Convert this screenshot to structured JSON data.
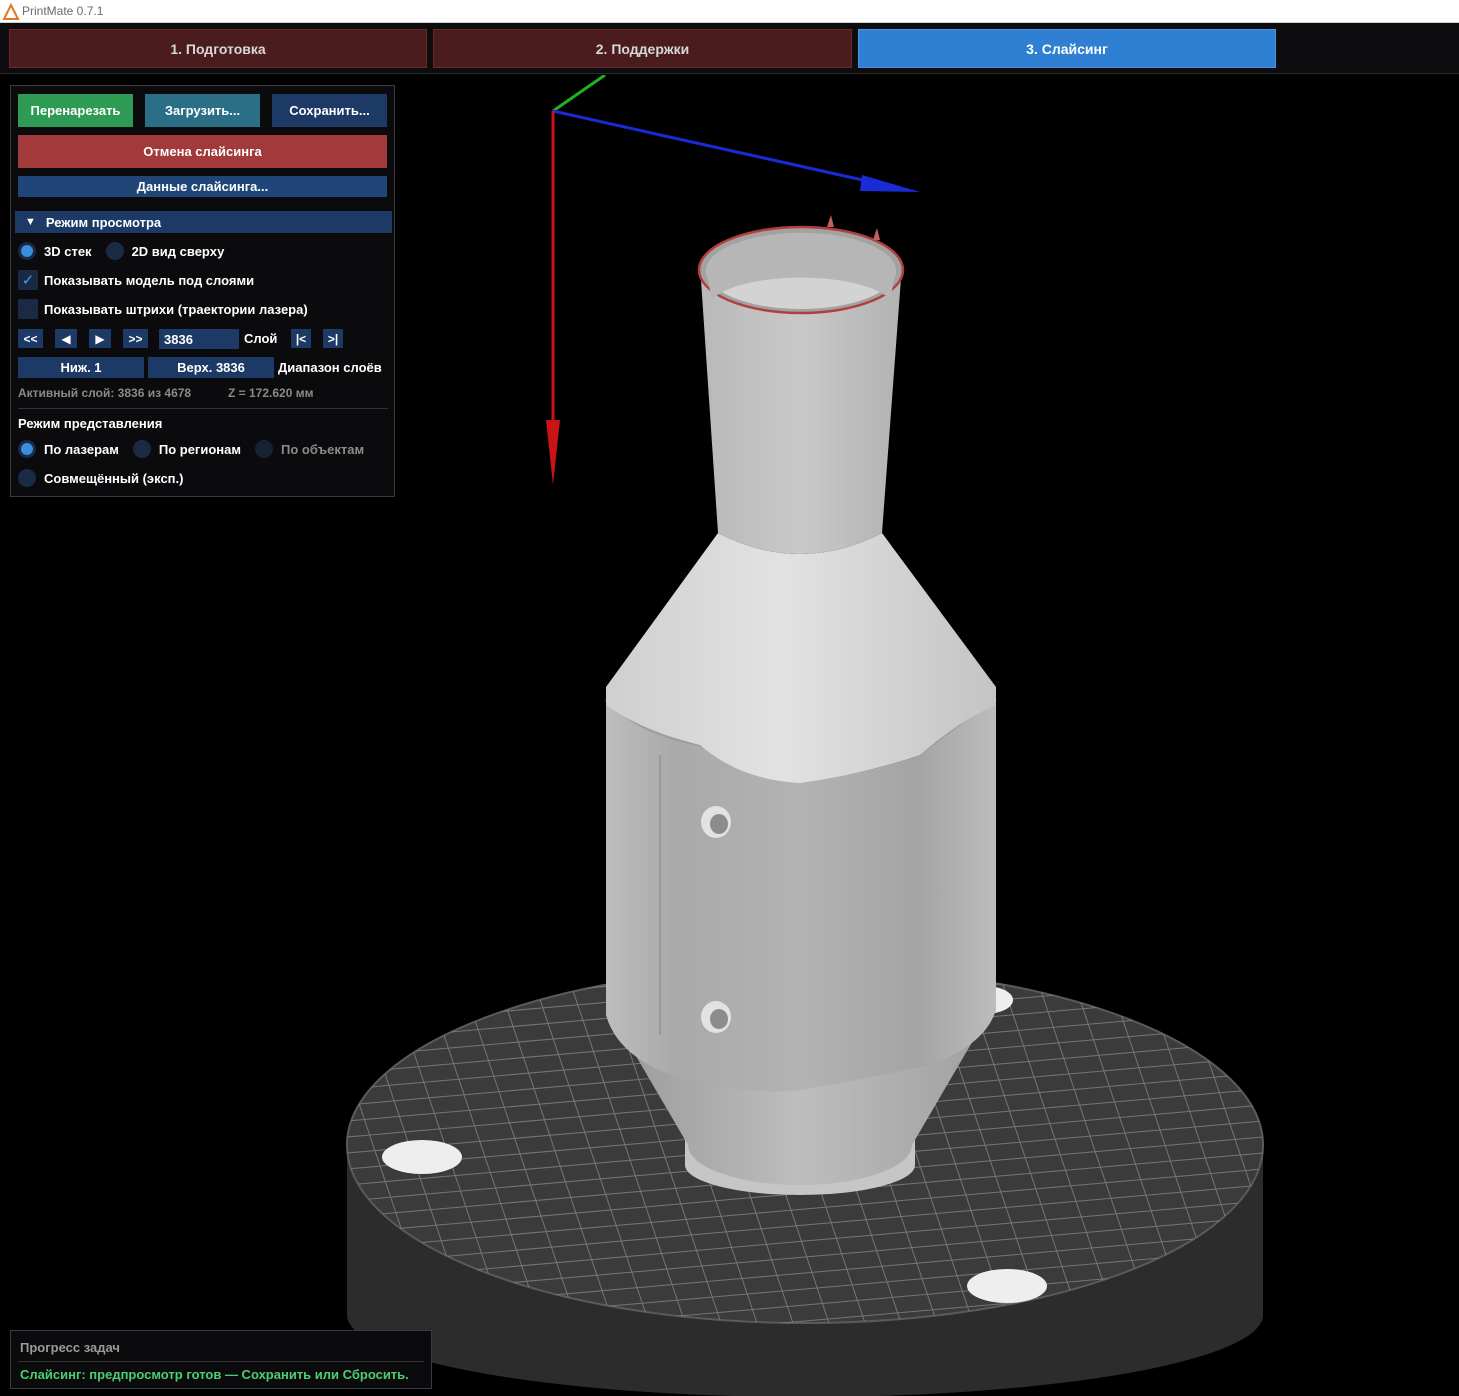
{
  "window": {
    "title": "PrintMate 0.7.1"
  },
  "tabs": [
    {
      "label": "1. Подготовка",
      "active": false
    },
    {
      "label": "2. Поддержки",
      "active": false
    },
    {
      "label": "3. Слайсинг",
      "active": true
    }
  ],
  "panel": {
    "reslice_label": "Перенарезать",
    "load_label": "Загрузить...",
    "save_label": "Сохранить...",
    "cancel_label": "Отмена слайсинга",
    "data_label": "Данные слайсинга...",
    "view_mode": {
      "header": "Режим просмотра",
      "options": [
        {
          "label": "3D стек",
          "selected": true
        },
        {
          "label": "2D вид сверху",
          "selected": false
        }
      ],
      "show_model_label": "Показывать модель под слоями",
      "show_model_checked": true,
      "show_hatches_label": "Показывать штрихи (траектории лазера)",
      "show_hatches_checked": false
    },
    "layer_nav": {
      "first_label": "<<",
      "prev_label": "◀",
      "next_label": "▶",
      "last_label": ">>",
      "layer_value": "3836",
      "layer_label": "Слой",
      "to_bottom_label": "|<",
      "to_top_label": ">|"
    },
    "range": {
      "low_label": "Ниж. 1",
      "high_label": "Верх. 3836",
      "range_label": "Диапазон слоёв"
    },
    "active_layer_text": "Активный слой: 3836 из 4678",
    "z_text": "Z = 172.620 мм",
    "render_mode": {
      "header": "Режим представления",
      "options": [
        {
          "label": "По лазерам",
          "selected": true,
          "enabled": true
        },
        {
          "label": "По регионам",
          "selected": false,
          "enabled": true
        },
        {
          "label": "По объектам",
          "selected": false,
          "enabled": false
        },
        {
          "label": "Совмещённый (эксп.)",
          "selected": false,
          "enabled": true
        }
      ]
    }
  },
  "progress": {
    "header": "Прогресс задач",
    "status": "Слайсинг: предпросмотр готов — Сохранить или Сбросить."
  },
  "colors": {
    "accent_blue": "#2f7fd3",
    "tab_inactive": "#4a1c1e",
    "status_green": "#4ccf6e",
    "axis_x": "#1a2bd6",
    "axis_y": "#22b022",
    "axis_z": "#c81414"
  }
}
